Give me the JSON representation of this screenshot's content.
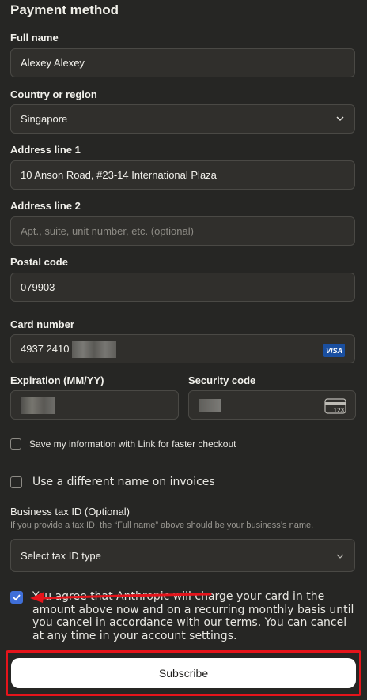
{
  "header": {
    "title": "Payment method"
  },
  "form": {
    "full_name": {
      "label": "Full name",
      "value": "Alexey Alexey"
    },
    "country": {
      "label": "Country or region",
      "value": "Singapore"
    },
    "address1": {
      "label": "Address line 1",
      "value": "10 Anson Road, #23-14 International Plaza"
    },
    "address2": {
      "label": "Address line 2",
      "placeholder": "Apt., suite, unit number, etc. (optional)"
    },
    "postal": {
      "label": "Postal code",
      "value": "079903"
    },
    "card": {
      "label": "Card number",
      "value": "4937 2410",
      "brand": "VISA"
    },
    "expiration": {
      "label": "Expiration (MM/YY)"
    },
    "security": {
      "label": "Security code",
      "card_icon_text": "123"
    },
    "save_link": {
      "label": "Save my information with Link for faster checkout",
      "checked": false
    },
    "different_name": {
      "label": "Use a different name on invoices",
      "checked": false
    },
    "tax": {
      "label": "Business tax ID (Optional)",
      "hint": "If you provide a tax ID, the “Full name” above should be your business’s name.",
      "select_value": "Select tax ID type"
    },
    "agree": {
      "checked": true,
      "text_before": "You agree that Anthropic will charge your card in the amount above now and on a recurring monthly basis until you cancel in accordance with our ",
      "terms_link": "terms",
      "text_after": ". You can cancel at any time in your account settings."
    },
    "subscribe_label": "Subscribe"
  },
  "colors": {
    "background": "#262624",
    "field_bg": "#302f2c",
    "checkbox_accent": "#3f6fd8",
    "annotation_red": "#e5141b"
  }
}
